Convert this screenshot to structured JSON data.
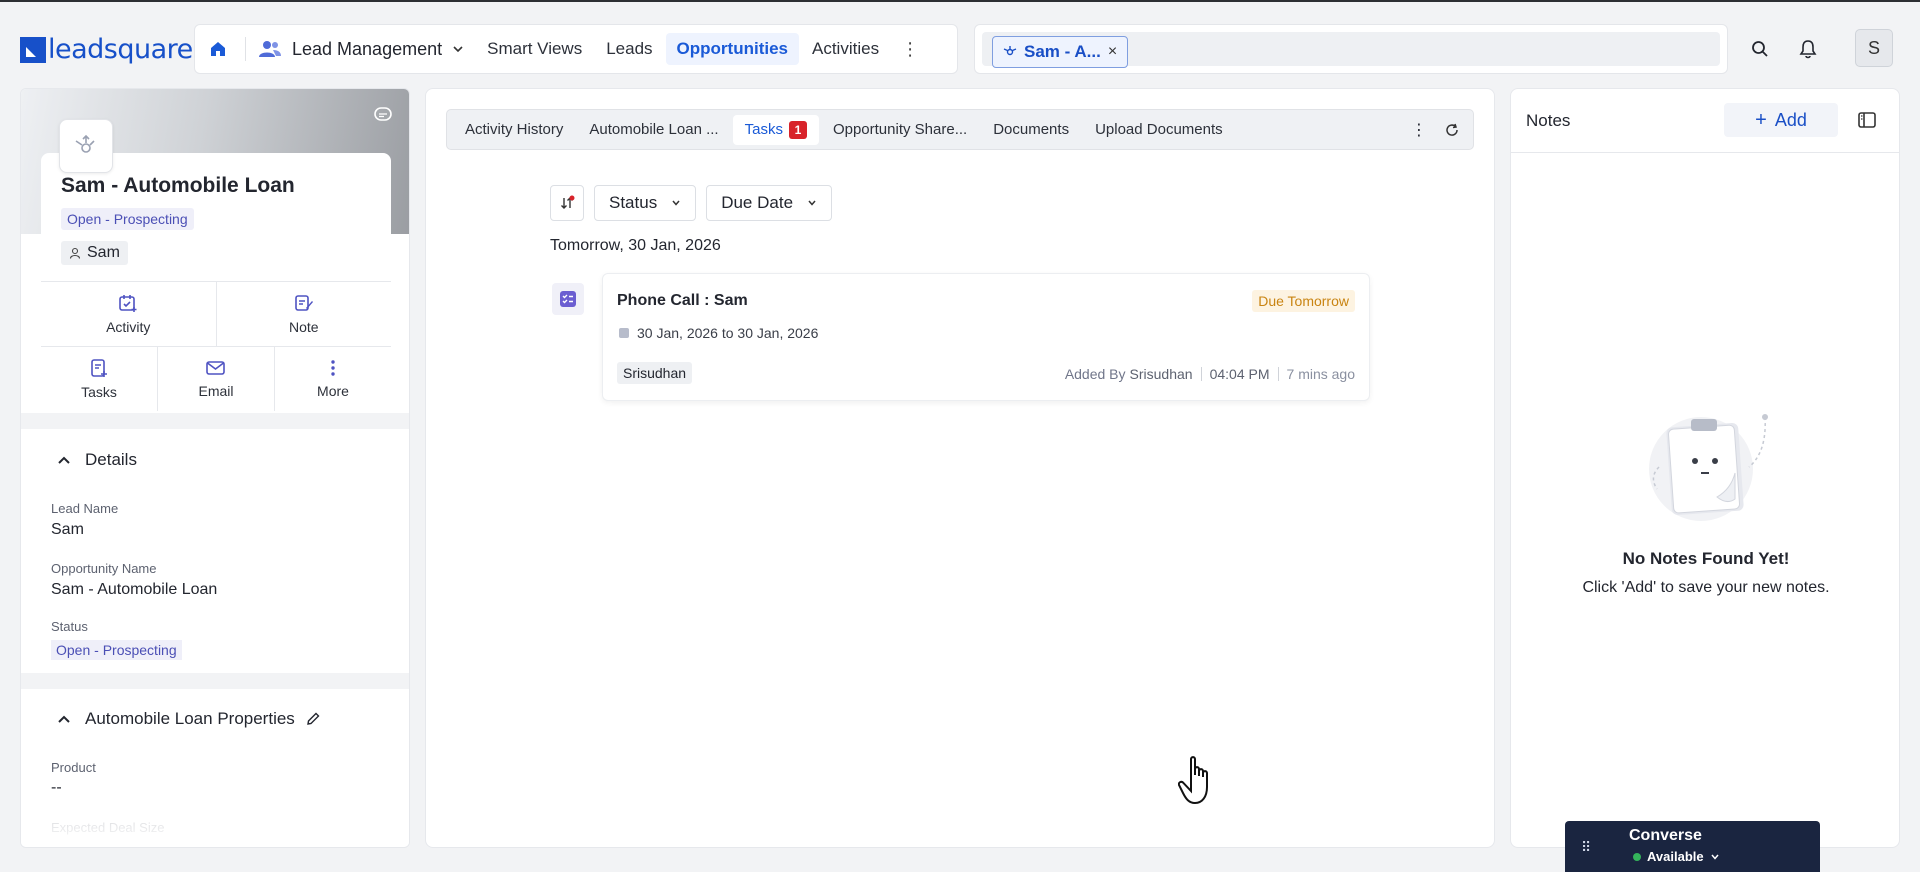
{
  "brand": {
    "logo_text": "leadsquared"
  },
  "nav": {
    "app_label": "Lead Management",
    "items": [
      {
        "label": "Smart Views",
        "active": false
      },
      {
        "label": "Leads",
        "active": false
      },
      {
        "label": "Opportunities",
        "active": true
      },
      {
        "label": "Activities",
        "active": false
      }
    ]
  },
  "search": {
    "chip_label": "Sam - A..."
  },
  "user": {
    "initial": "S"
  },
  "opportunity": {
    "title": "Sam - Automobile Loan",
    "status": "Open - Prospecting",
    "owner": "Sam",
    "actions_top": [
      "Activity",
      "Note"
    ],
    "actions_bottom": [
      "Tasks",
      "Email",
      "More"
    ]
  },
  "details": {
    "heading": "Details",
    "fields": [
      {
        "label": "Lead Name",
        "value": "Sam"
      },
      {
        "label": "Opportunity Name",
        "value": "Sam - Automobile Loan"
      },
      {
        "label": "Status",
        "value": "Open - Prospecting"
      }
    ]
  },
  "properties": {
    "heading": "Automobile Loan Properties",
    "fields": [
      {
        "label": "Product",
        "value": "--"
      },
      {
        "label": "Expected Deal Size",
        "value": ""
      }
    ]
  },
  "tabs": [
    {
      "label": "Activity History"
    },
    {
      "label": "Automobile Loan ..."
    },
    {
      "label": "Tasks",
      "badge": "1",
      "active": true
    },
    {
      "label": "Opportunity Share..."
    },
    {
      "label": "Documents"
    },
    {
      "label": "Upload Documents"
    }
  ],
  "filters": {
    "status_label": "Status",
    "due_label": "Due Date"
  },
  "task_group": {
    "date_heading": "Tomorrow, 30 Jan, 2026"
  },
  "task": {
    "title": "Phone Call : Sam",
    "due_badge": "Due Tomorrow",
    "date_range": "30 Jan, 2026 to 30 Jan, 2026",
    "owner": "Srisudhan",
    "added_by_prefix": "Added By",
    "added_by": "Srisudhan",
    "time": "04:04 PM",
    "ago": "7 mins ago"
  },
  "notes": {
    "title": "Notes",
    "add_label": "Add",
    "empty_title": "No Notes Found Yet!",
    "empty_sub": "Click 'Add' to save your new notes."
  },
  "converse": {
    "title": "Converse",
    "status": "Available"
  },
  "colors": {
    "primary": "#1a5ad7",
    "badge_red": "#d8232a",
    "due_orange": "#c98412",
    "converse_bg": "#1a2540"
  }
}
